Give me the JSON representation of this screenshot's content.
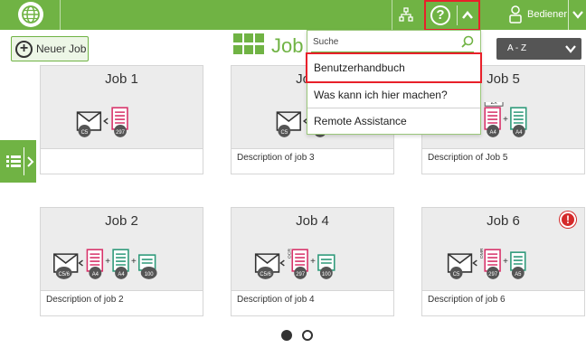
{
  "header": {
    "user_label": "Bediener"
  },
  "toolbar": {
    "new_job_label": "Neuer Job",
    "jobs_title": "Job",
    "sort_label": "A - Z"
  },
  "help_menu": {
    "search_placeholder": "Suche",
    "items": [
      "Benutzerhandbuch",
      "Was kann ich hier machen?",
      "Remote Assistance"
    ]
  },
  "jobs": [
    {
      "title": "Job 1",
      "description": "",
      "envelope": "C5",
      "docs": [
        "297"
      ]
    },
    {
      "title": "Job 3",
      "description": "Description of job 3",
      "envelope": "C5",
      "docs": [
        "297"
      ]
    },
    {
      "title": "Job 5",
      "description": "Description of Job 5",
      "envelope": "C5",
      "docs": [
        "A4",
        "A4"
      ],
      "copies": "2x"
    },
    {
      "title": "Job 2",
      "description": "Description of job 2",
      "envelope": "C5/6",
      "docs": [
        "A4",
        "A4",
        "100"
      ]
    },
    {
      "title": "Job 4",
      "description": "Description of job 4",
      "envelope": "C5/6",
      "docs": [
        "297",
        "100"
      ],
      "mark": "OCR"
    },
    {
      "title": "Job 6",
      "description": "Description of job 6",
      "envelope": "C5",
      "docs": [
        "297",
        "A5"
      ],
      "mark": "OMR",
      "warning": "!"
    }
  ],
  "pagination": {
    "pages": 2,
    "current": 1
  },
  "colors": {
    "accent": "#70b344",
    "highlight": "#e8202a",
    "doc_red": "#d8336a",
    "doc_teal": "#2e9a7a"
  }
}
